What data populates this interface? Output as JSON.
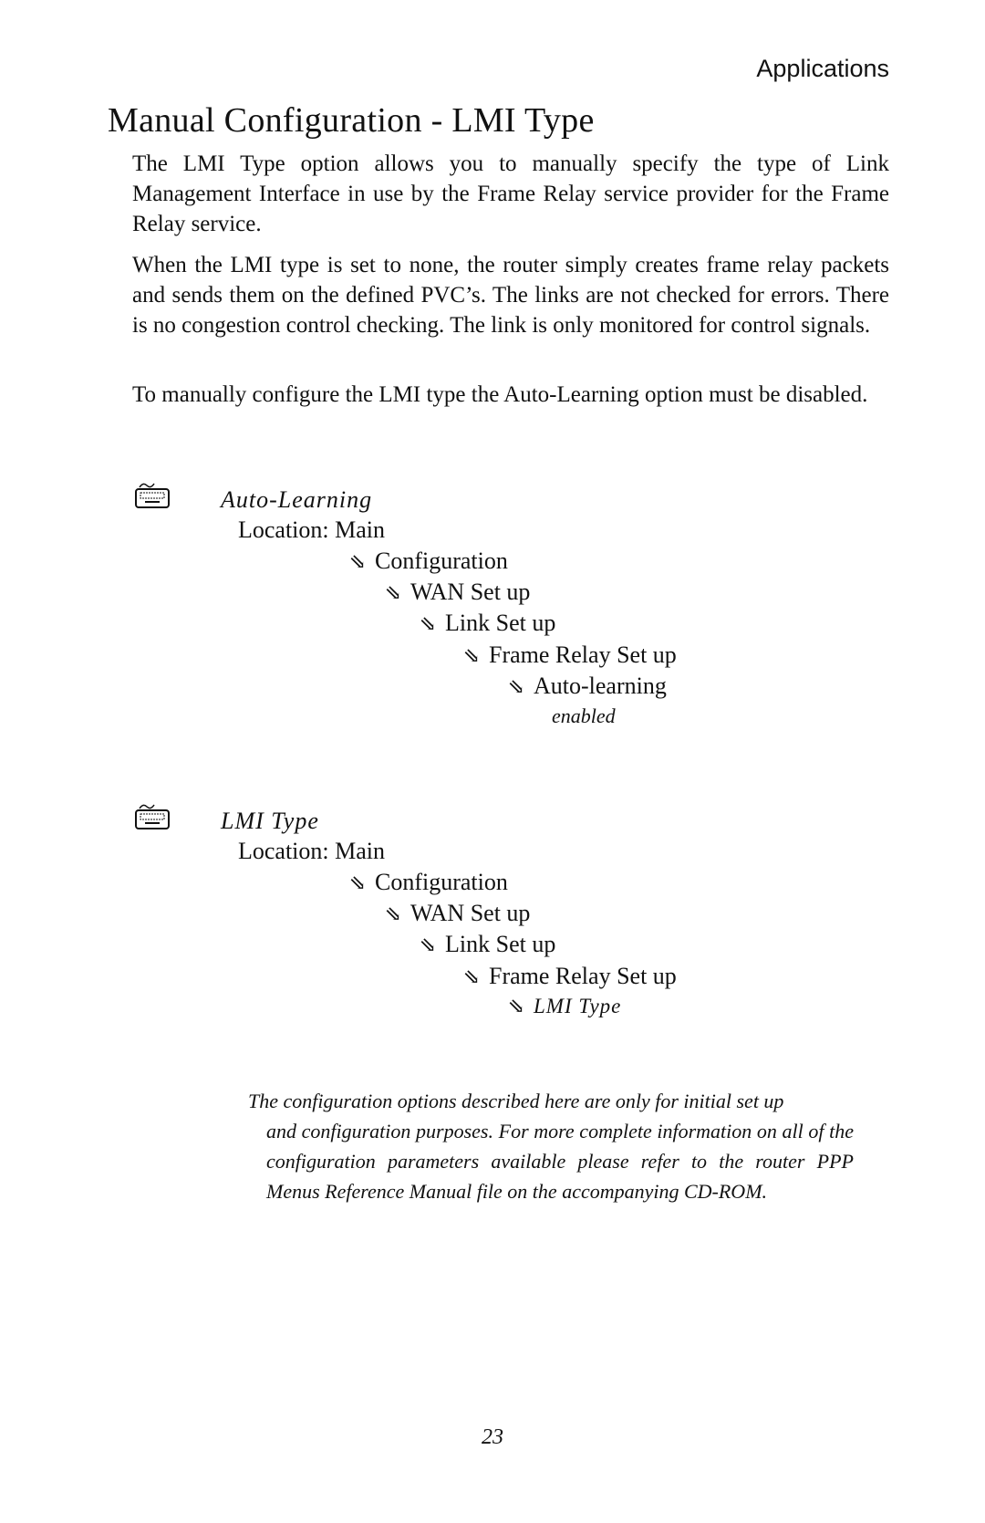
{
  "header": {
    "section": "Applications"
  },
  "title": "Manual Configuration - LMI Type",
  "paragraphs": [
    "The LMI Type option allows you to manually specify the type of Link Management Interface in use by the Frame Relay service provider for the Frame Relay service.",
    "When the LMI type is set to none, the router simply creates frame relay packets and sends them on the defined PVC’s. The links are not checked for errors. There is no congestion control checking. The link is only monitored for control signals.",
    "To manually configure the LMI type the Auto-Learning option must be disabled."
  ],
  "sections": [
    {
      "icon": "keyboard-icon",
      "title": "Auto-Learning",
      "location_label": "Location: Main",
      "path": [
        "Configuration",
        "WAN Set up",
        "Link Set up",
        "Frame Relay Set up",
        "Auto-learning"
      ],
      "value": "enabled"
    },
    {
      "icon": "keyboard-icon",
      "title": "LMI Type",
      "location_label": "Location: Main",
      "path": [
        "Configuration",
        "WAN Set up",
        "Link Set up",
        "Frame Relay Set up",
        "LMI Type"
      ]
    }
  ],
  "note": {
    "line1": "The configuration options described here are only for initial set up",
    "rest": "and configuration purposes.  For more complete information on all of the configuration parameters available please refer to the router PPP Menus Reference Manual file on the accompanying CD-ROM."
  },
  "arrow_glyph": "⇘",
  "page_number": "23"
}
